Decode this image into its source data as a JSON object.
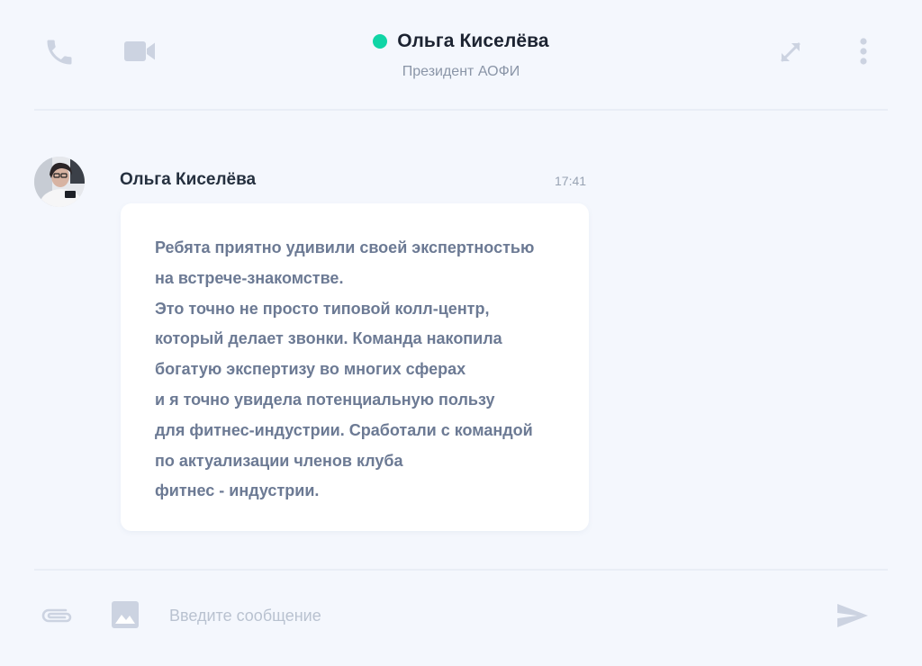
{
  "header": {
    "phone_icon": "phone-icon",
    "video_icon": "video-camera-icon",
    "contact": {
      "name": "Ольга Киселёва",
      "role": "Президент АОФИ",
      "status_color": "#10d5a6"
    },
    "expand_icon": "expand-arrows-icon",
    "more_icon": "more-vertical-icon"
  },
  "message": {
    "author": "Ольга Киселёва",
    "time": "17:41",
    "lines": [
      "Ребята приятно удивили своей экспертностью",
      "на встрече-знакомстве.",
      "Это точно не просто типовой колл-центр,",
      "который делает звонки. Команда накопила",
      "богатую экспертизу во многих сферах",
      "и я точно увидела потенциальную пользу",
      "для фитнес-индустрии. Сработали с командой",
      "по актуализации членов клуба",
      "фитнес - индустрии."
    ]
  },
  "composer": {
    "attach_icon": "paperclip-icon",
    "image_icon": "image-icon",
    "placeholder": "Введите сообщение",
    "value": "",
    "send_icon": "send-icon"
  },
  "colors": {
    "background": "#f4f7fd",
    "bubble": "#ffffff",
    "icon": "#ccd3e1",
    "name_text": "#1c2331",
    "message_text": "#6c7a94",
    "muted_text": "#8a95a7"
  }
}
